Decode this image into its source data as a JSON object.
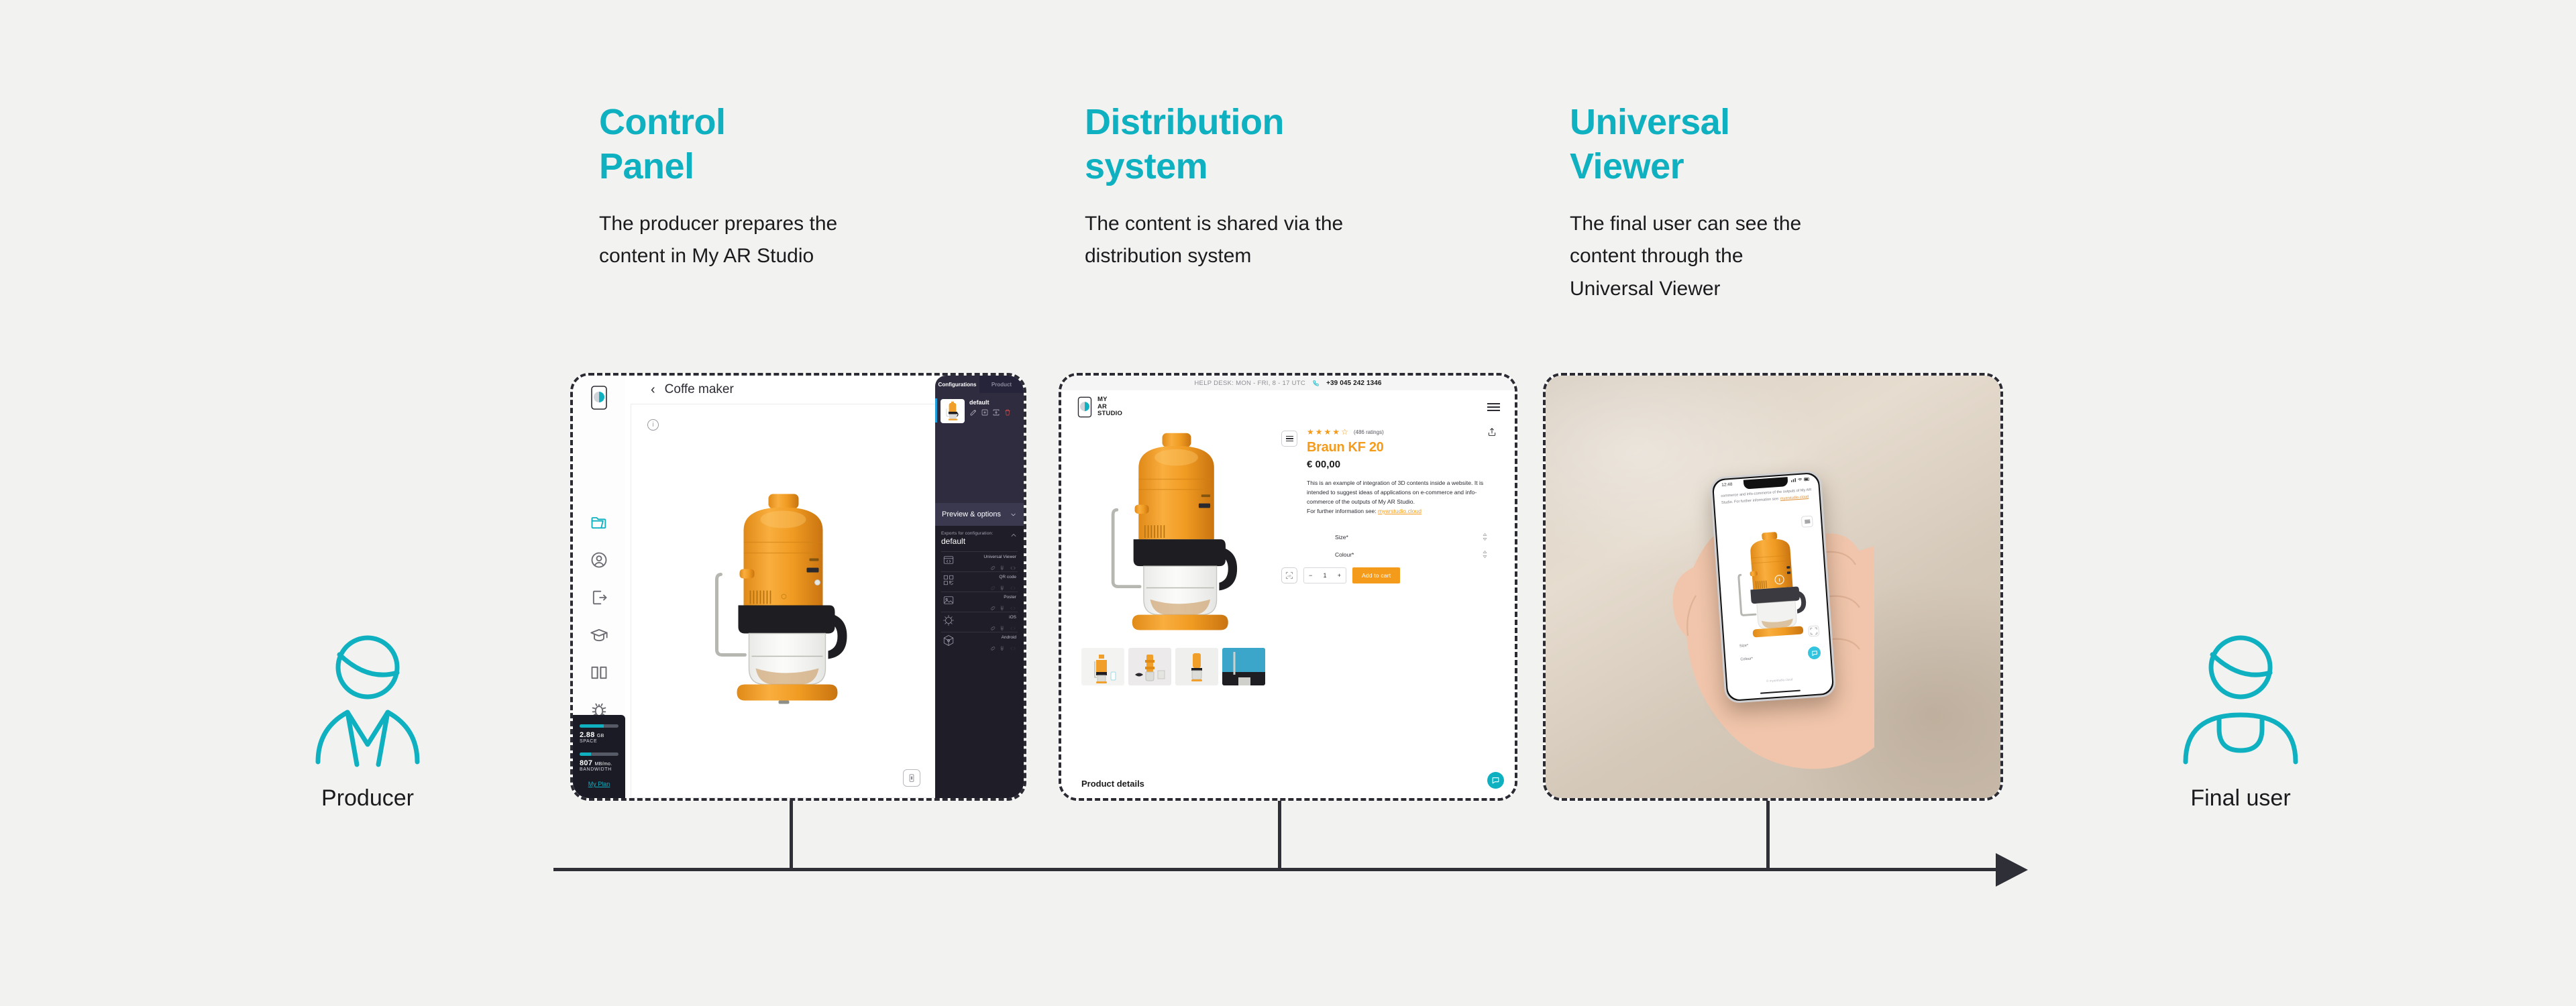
{
  "columns": [
    {
      "id": "control-panel",
      "title": "Control\nPanel",
      "description": "The producer prepares the\ncontent in My AR Studio"
    },
    {
      "id": "distribution-system",
      "title": "Distribution\nsystem",
      "description": "The content is shared via the\ndistribution system"
    },
    {
      "id": "universal-viewer",
      "title": "Universal\nViewer",
      "description": "The final user can see the\ncontent through the\nUniversal Viewer"
    }
  ],
  "actors": {
    "left": {
      "label": "Producer",
      "icon": "producer-avatar-icon"
    },
    "right": {
      "label": "Final user",
      "icon": "final-user-avatar-icon"
    }
  },
  "control_panel": {
    "header": {
      "back_icon": "chevron-left-icon",
      "title": "Coffe maker"
    },
    "sidebar": {
      "logo": "my-ar-studio-logo",
      "items": [
        {
          "name": "projects-folder",
          "icon": "folder-icon",
          "active": true
        },
        {
          "name": "account",
          "icon": "user-circle-icon",
          "active": false
        },
        {
          "name": "logout",
          "icon": "logout-icon",
          "active": false
        },
        {
          "name": "academy",
          "icon": "graduation-cap-icon",
          "active": false
        },
        {
          "name": "documentation",
          "icon": "book-icon",
          "active": false
        },
        {
          "name": "report-bug",
          "icon": "bug-icon",
          "active": false
        },
        {
          "name": "support-chat",
          "icon": "chat-bubble-icon",
          "active": false
        }
      ],
      "plan": {
        "space_value": "2.88",
        "space_unit": "GB",
        "space_label": "SPACE",
        "space_pct": 62,
        "bandwidth_value": "807",
        "bandwidth_unit": "MB/mo.",
        "bandwidth_label": "BANDWIDTH",
        "bandwidth_pct": 30,
        "link": "My Plan"
      }
    },
    "canvas": {
      "info_icon": "info-icon",
      "ar_icon": "ar-view-icon"
    },
    "right_panel": {
      "tabs": [
        {
          "label": "Configurations",
          "active": true
        },
        {
          "label": "Product",
          "active": false
        }
      ],
      "configuration": {
        "name": "default",
        "actions": [
          "edit-icon",
          "duplicate-icon",
          "rename-icon",
          "delete-icon"
        ]
      },
      "preview_section": {
        "label": "Preview & options",
        "chevron": "chevron-down-icon"
      },
      "exports": {
        "caption": "Exports for configuration:",
        "config_name": "default",
        "chevron": "chevron-up-icon",
        "rows": [
          {
            "label": "Universal Viewer",
            "icon": "code-window-icon",
            "actions": [
              "link-icon",
              "download-icon",
              "embed-code-icon"
            ]
          },
          {
            "label": "QR code",
            "icon": "qr-code-icon",
            "actions": [
              "link-icon",
              "download-icon",
              "embed-code-icon"
            ]
          },
          {
            "label": "Poster",
            "icon": "image-icon",
            "actions": [
              "link-icon",
              "download-icon",
              "embed-code-icon"
            ]
          },
          {
            "label": "iOS",
            "icon": "ar-anchor-icon",
            "actions": [
              "link-icon",
              "download-icon",
              "embed-code-icon"
            ]
          },
          {
            "label": "Android",
            "icon": "3d-cube-icon",
            "actions": [
              "link-icon",
              "download-icon",
              "embed-code-icon"
            ]
          }
        ]
      }
    }
  },
  "website": {
    "topbar": {
      "hours": "HELP DESK: MON - FRI, 8 - 17 UTC",
      "phone_icon": "phone-icon",
      "phone": "+39 045 242 1346"
    },
    "logo_lines": [
      "MY",
      "AR",
      "STUDIO"
    ],
    "menu_icon": "hamburger-menu-icon",
    "product": {
      "rating_filled": 4,
      "rating_total": 5,
      "ratings_text": "(486 ratings)",
      "name": "Braun KF 20",
      "price": "€ 00,00",
      "description": "This is an example of integration of 3D contents inside a website. It is intended to suggest ideas of applications on e-commerce and info-commerce of the outputs of My AR Studio.\nFor further information see: ",
      "link_text": "myarstudio.cloud",
      "share_icon": "share-icon",
      "list_icon": "list-view-icon",
      "ar_icon": "view-in-ar-icon",
      "options": [
        {
          "label": "Size*",
          "icon": "stepper-arrows-icon"
        },
        {
          "label": "Colour*",
          "icon": "stepper-arrows-icon"
        }
      ],
      "quantity": {
        "minus": "−",
        "value": "1",
        "plus": "+"
      },
      "add_to_cart": "Add to cart",
      "thumbnails": 4
    },
    "details_heading": "Product details",
    "chat_icon": "chat-bubble-icon"
  },
  "viewer_photo": {
    "phone": {
      "status_time": "12:48",
      "status_icons": [
        "signal-icon",
        "wifi-icon",
        "battery-icon"
      ],
      "page_text": "commerce and info-commerce of the outputs of My AR Studio.\nFor further information see: ",
      "link_text": "myarstudio.cloud",
      "options": [
        {
          "label": "Size*"
        },
        {
          "label": "Colour*"
        }
      ],
      "credit": "© myarstudio.cloud",
      "chat_icon": "chat-bubble-icon",
      "ar_icon": "view-in-ar-icon",
      "menu_icon": "list-view-icon"
    }
  },
  "colors": {
    "accent_teal": "#0fb1c1",
    "accent_orange": "#f59b1c",
    "text_dark": "#1b1b1e",
    "panel_dark": "#2e2c3e",
    "background": "#f2f2f1",
    "timeline": "#2f2f38"
  }
}
